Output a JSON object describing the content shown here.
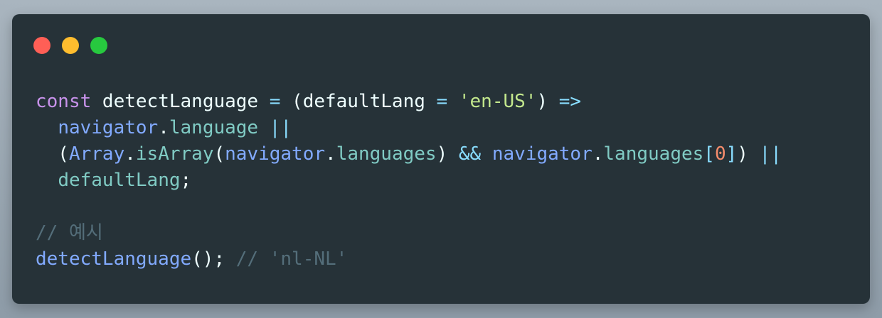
{
  "window": {
    "colors": {
      "background": "#263238",
      "close": "#ff5f56",
      "minimize": "#ffbd2e",
      "maximize": "#27c93f"
    }
  },
  "code": {
    "lines": [
      {
        "tokens": [
          {
            "text": "const",
            "kind": "keyword"
          },
          {
            "text": " detectLanguage ",
            "kind": "identifier"
          },
          {
            "text": "=",
            "kind": "operator"
          },
          {
            "text": " (defaultLang ",
            "kind": "identifier"
          },
          {
            "text": "=",
            "kind": "operator"
          },
          {
            "text": " ",
            "kind": "punctuation"
          },
          {
            "text": "'en-US'",
            "kind": "string"
          },
          {
            "text": ") ",
            "kind": "punctuation"
          },
          {
            "text": "=>",
            "kind": "operator"
          }
        ]
      },
      {
        "tokens": [
          {
            "text": "  ",
            "kind": "punctuation"
          },
          {
            "text": "navigator",
            "kind": "global"
          },
          {
            "text": ".",
            "kind": "punctuation"
          },
          {
            "text": "language",
            "kind": "property"
          },
          {
            "text": " ",
            "kind": "punctuation"
          },
          {
            "text": "||",
            "kind": "operator"
          }
        ]
      },
      {
        "tokens": [
          {
            "text": "  (",
            "kind": "punctuation"
          },
          {
            "text": "Array",
            "kind": "global"
          },
          {
            "text": ".",
            "kind": "punctuation"
          },
          {
            "text": "isArray",
            "kind": "property"
          },
          {
            "text": "(",
            "kind": "punctuation"
          },
          {
            "text": "navigator",
            "kind": "global"
          },
          {
            "text": ".",
            "kind": "punctuation"
          },
          {
            "text": "languages",
            "kind": "property"
          },
          {
            "text": ") ",
            "kind": "punctuation"
          },
          {
            "text": "&&",
            "kind": "operator"
          },
          {
            "text": " ",
            "kind": "punctuation"
          },
          {
            "text": "navigator",
            "kind": "global"
          },
          {
            "text": ".",
            "kind": "punctuation"
          },
          {
            "text": "languages",
            "kind": "property"
          },
          {
            "text": "[",
            "kind": "operator"
          },
          {
            "text": "0",
            "kind": "number"
          },
          {
            "text": "]",
            "kind": "operator"
          },
          {
            "text": ") ",
            "kind": "punctuation"
          },
          {
            "text": "||",
            "kind": "operator"
          }
        ]
      },
      {
        "tokens": [
          {
            "text": "  ",
            "kind": "punctuation"
          },
          {
            "text": "defaultLang",
            "kind": "property"
          },
          {
            "text": ";",
            "kind": "punctuation"
          }
        ]
      },
      {
        "tokens": []
      },
      {
        "tokens": [
          {
            "text": "// 예시",
            "kind": "comment"
          }
        ]
      },
      {
        "tokens": [
          {
            "text": "detectLanguage",
            "kind": "function"
          },
          {
            "text": "(); ",
            "kind": "punctuation"
          },
          {
            "text": "// 'nl-NL'",
            "kind": "comment"
          }
        ]
      }
    ]
  }
}
